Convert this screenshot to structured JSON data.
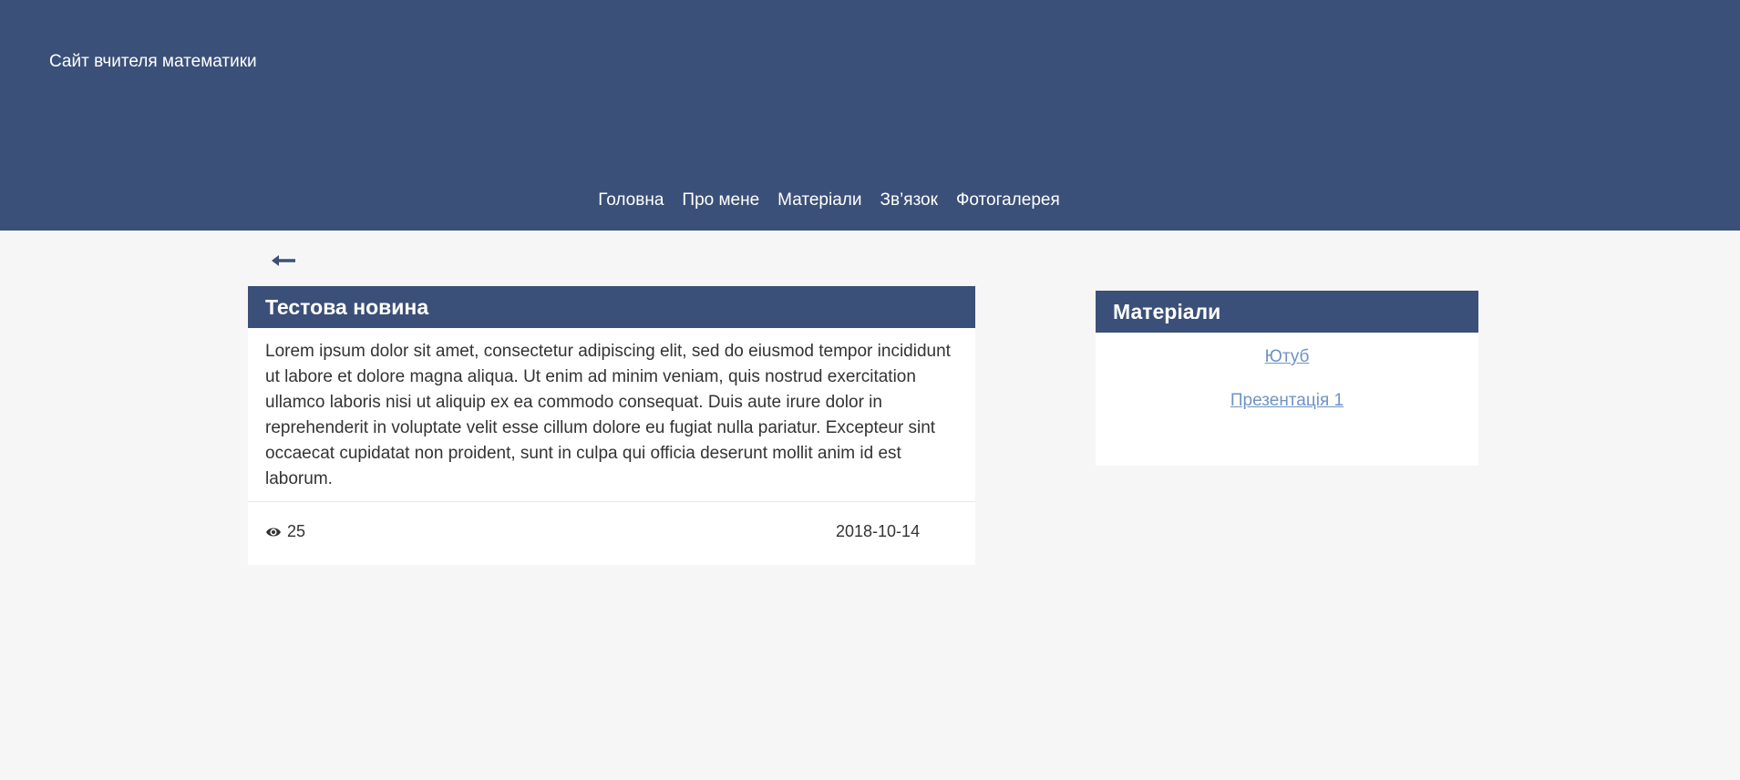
{
  "header": {
    "site_title": "Сайт вчителя математики",
    "nav": [
      "Головна",
      "Про мене",
      "Матеріали",
      "Зв’язок",
      "Фотогалерея"
    ],
    "background_color": "#3b5078"
  },
  "back": {
    "icon": "arrow-left-icon"
  },
  "post": {
    "title": "Тестова новина",
    "body": "Lorem ipsum dolor sit amet, consectetur adipiscing elit, sed do eiusmod tempor incididunt ut labore et dolore magna aliqua. Ut enim ad minim veniam, quis nostrud exercitation ullamco laboris nisi ut aliquip ex ea commodo consequat. Duis aute irure dolor in reprehenderit in voluptate velit esse cillum dolore eu fugiat nulla pariatur. Excepteur sint occaecat cupidatat non proident, sunt in culpa qui officia deserunt mollit anim id est laborum.",
    "views_icon": "eye-icon",
    "views": "25",
    "date": "2018-10-14"
  },
  "sidebar": {
    "title": "Матеріали",
    "links": [
      "Ютуб",
      "Презентація 1"
    ],
    "link_color": "#6f93c6"
  }
}
